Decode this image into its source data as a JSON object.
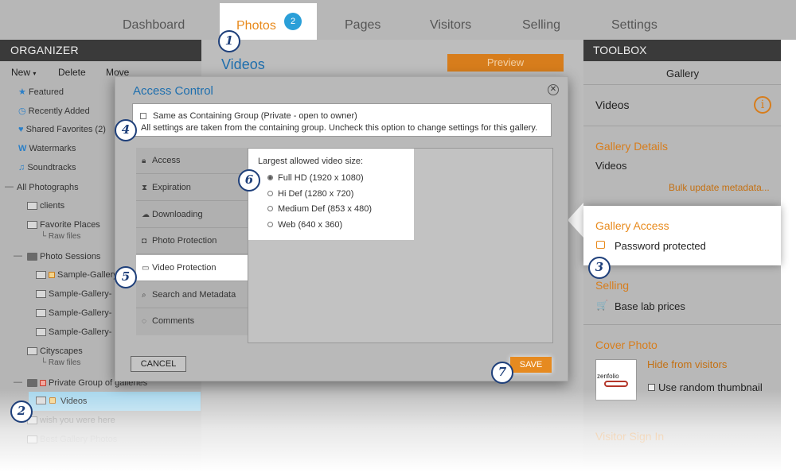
{
  "nav": {
    "items": [
      "Dashboard",
      "Photos",
      "Pages",
      "Visitors",
      "Selling",
      "Settings"
    ],
    "active_badge": "2"
  },
  "organizer": {
    "header": "ORGANIZER",
    "toolbar": {
      "new": "New",
      "delete": "Delete",
      "move": "Move"
    },
    "items": {
      "featured": "Featured",
      "recently_added": "Recently Added",
      "shared_favorites": "Shared Favorites (2)",
      "watermarks": "Watermarks",
      "soundtracks": "Soundtracks",
      "all_photographs": "All Photographs",
      "clients": "clients",
      "favorite_places": "Favorite Places",
      "raw_files_1": "└ Raw files",
      "photo_sessions": "Photo Sessions",
      "sample_gallery_1": "Sample-Gallery",
      "sample_gallery_2": "Sample-Gallery-",
      "sample_gallery_3": "Sample-Gallery-",
      "sample_gallery_4": "Sample-Gallery-",
      "cityscapes": "Cityscapes",
      "raw_files_2": "└ Raw files",
      "private_group": "Private Group of galleries",
      "videos": "Videos",
      "wish": "wish you were here",
      "best_gallery": "Best Gallery Photos"
    }
  },
  "main": {
    "title": "Videos",
    "preview": "Preview"
  },
  "toolbox": {
    "header": "TOOLBOX",
    "gallery": "Gallery",
    "videos": "Videos",
    "gallery_details": "Gallery Details",
    "details_videos": "Videos",
    "bulk_update": "Bulk update metadata...",
    "gallery_access": "Gallery Access",
    "password_protected": "Password protected",
    "selling": "Selling",
    "base_lab_prices": "Base lab prices",
    "cover_photo": "Cover Photo",
    "hide_from_visitors": "Hide from visitors",
    "use_random_thumbnail": "Use random thumbnail",
    "zenfolio": "zenfolio",
    "visitor_sign_in": "Visitor Sign In"
  },
  "dialog": {
    "title": "Access Control",
    "same_label": "Same as Containing Group (Private - open to owner)",
    "same_desc": "All settings are taken from the containing group. Uncheck this option to change settings for this gallery.",
    "tabs": [
      "Access",
      "Expiration",
      "Downloading",
      "Photo Protection",
      "Video Protection",
      "Search and Metadata",
      "Comments"
    ],
    "size_title": "Largest allowed video size:",
    "options": [
      "Full HD (1920 x 1080)",
      "Hi Def (1280 x 720)",
      "Medium Def (853 x 480)",
      "Web (640 x 360)"
    ],
    "selected_option": "Full HD (1920 x 1080)",
    "cancel": "CANCEL",
    "save": "SAVE"
  },
  "callouts": [
    "1",
    "2",
    "3",
    "4",
    "5",
    "6",
    "7"
  ],
  "colors": {
    "accent_orange": "#e88a1c",
    "link_blue": "#1f6fae",
    "badge_blue": "#2a9fd8",
    "callout_navy": "#1e3f7a"
  }
}
